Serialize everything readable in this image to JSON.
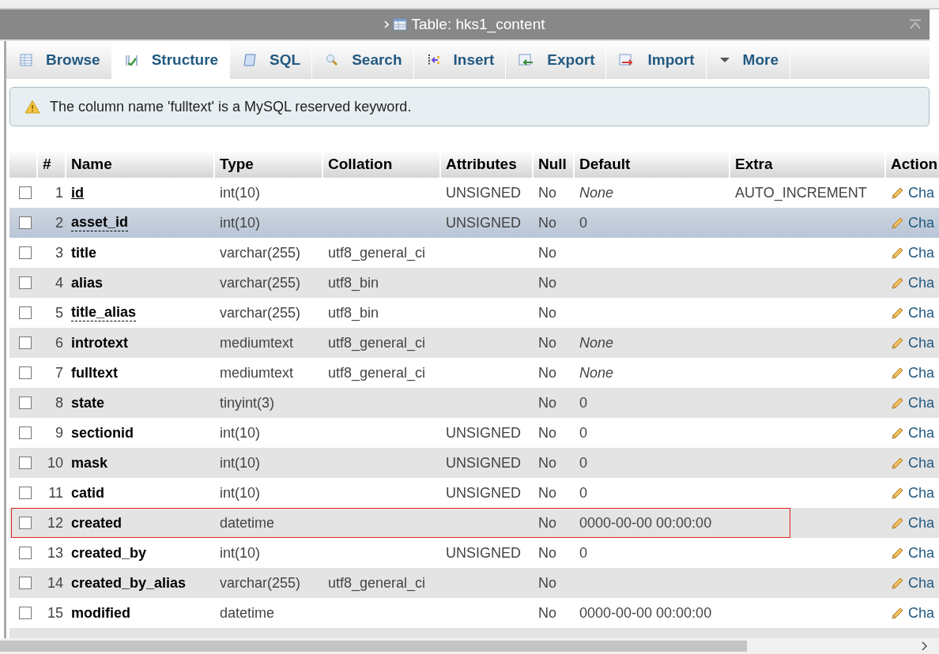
{
  "window": {
    "title": "Table: hks1_content"
  },
  "tabs": [
    {
      "label": "Browse",
      "selected": false
    },
    {
      "label": "Structure",
      "selected": true
    },
    {
      "label": "SQL",
      "selected": false
    },
    {
      "label": "Search",
      "selected": false
    },
    {
      "label": "Insert",
      "selected": false
    },
    {
      "label": "Export",
      "selected": false
    },
    {
      "label": "Import",
      "selected": false
    },
    {
      "label": "More",
      "selected": false
    }
  ],
  "notice": {
    "text": "The column name 'fulltext' is a MySQL reserved keyword."
  },
  "table": {
    "columns": [
      "#",
      "Name",
      "Type",
      "Collation",
      "Attributes",
      "Null",
      "Default",
      "Extra",
      "Action"
    ],
    "rows": [
      {
        "checked": false,
        "highlighted": false,
        "marked": false,
        "number": "1",
        "name": "id",
        "kind": "primary",
        "type": "int(10)",
        "attributes": "UNSIGNED",
        "null": "No",
        "default": "None",
        "default_italic": true,
        "extra": "AUTO_INCREMENT",
        "action": "Cha"
      },
      {
        "checked": false,
        "highlighted": true,
        "marked": false,
        "number": "2",
        "name": "asset_id",
        "kind": "index",
        "type": "int(10)",
        "attributes": "UNSIGNED",
        "null": "No",
        "default": "0",
        "default_italic": false,
        "action": "Cha"
      },
      {
        "checked": false,
        "highlighted": false,
        "marked": false,
        "number": "3",
        "name": "title",
        "type": "varchar(255)",
        "collation": "utf8_general_ci",
        "null": "No",
        "action": "Cha"
      },
      {
        "checked": false,
        "highlighted": false,
        "marked": false,
        "number": "4",
        "name": "alias",
        "type": "varchar(255)",
        "collation": "utf8_bin",
        "null": "No",
        "action": "Cha"
      },
      {
        "checked": false,
        "highlighted": false,
        "marked": false,
        "number": "5",
        "name": "title_alias",
        "kind": "index",
        "type": "varchar(255)",
        "collation": "utf8_bin",
        "null": "No",
        "action": "Cha"
      },
      {
        "checked": false,
        "highlighted": false,
        "marked": false,
        "number": "6",
        "name": "introtext",
        "type": "mediumtext",
        "collation": "utf8_general_ci",
        "null": "No",
        "default": "None",
        "default_italic": true,
        "action": "Cha"
      },
      {
        "checked": false,
        "highlighted": false,
        "marked": false,
        "number": "7",
        "name": "fulltext",
        "type": "mediumtext",
        "collation": "utf8_general_ci",
        "null": "No",
        "default": "None",
        "default_italic": true,
        "action": "Cha"
      },
      {
        "checked": false,
        "highlighted": false,
        "marked": false,
        "number": "8",
        "name": "state",
        "type": "tinyint(3)",
        "null": "No",
        "default": "0",
        "default_italic": false,
        "action": "Cha"
      },
      {
        "checked": false,
        "highlighted": false,
        "marked": false,
        "number": "9",
        "name": "sectionid",
        "type": "int(10)",
        "attributes": "UNSIGNED",
        "null": "No",
        "default": "0",
        "default_italic": false,
        "action": "Cha"
      },
      {
        "checked": false,
        "highlighted": false,
        "marked": false,
        "number": "10",
        "name": "mask",
        "type": "int(10)",
        "attributes": "UNSIGNED",
        "null": "No",
        "default": "0",
        "default_italic": false,
        "action": "Cha"
      },
      {
        "checked": false,
        "highlighted": false,
        "marked": false,
        "number": "11",
        "name": "catid",
        "type": "int(10)",
        "attributes": "UNSIGNED",
        "null": "No",
        "default": "0",
        "default_italic": false,
        "action": "Cha"
      },
      {
        "checked": false,
        "highlighted": false,
        "marked": true,
        "number": "12",
        "name": "created",
        "type": "datetime",
        "null": "No",
        "default": "0000-00-00 00:00:00",
        "default_italic": false,
        "action": "Cha"
      },
      {
        "checked": false,
        "highlighted": false,
        "marked": false,
        "number": "13",
        "name": "created_by",
        "type": "int(10)",
        "attributes": "UNSIGNED",
        "null": "No",
        "default": "0",
        "default_italic": false,
        "action": "Cha"
      },
      {
        "checked": false,
        "highlighted": false,
        "marked": false,
        "number": "14",
        "name": "created_by_alias",
        "type": "varchar(255)",
        "collation": "utf8_general_ci",
        "null": "No",
        "action": "Cha"
      },
      {
        "checked": false,
        "highlighted": false,
        "marked": false,
        "number": "15",
        "name": "modified",
        "type": "datetime",
        "null": "No",
        "default": "0000-00-00 00:00:00",
        "default_italic": false,
        "action": "Cha"
      }
    ]
  }
}
